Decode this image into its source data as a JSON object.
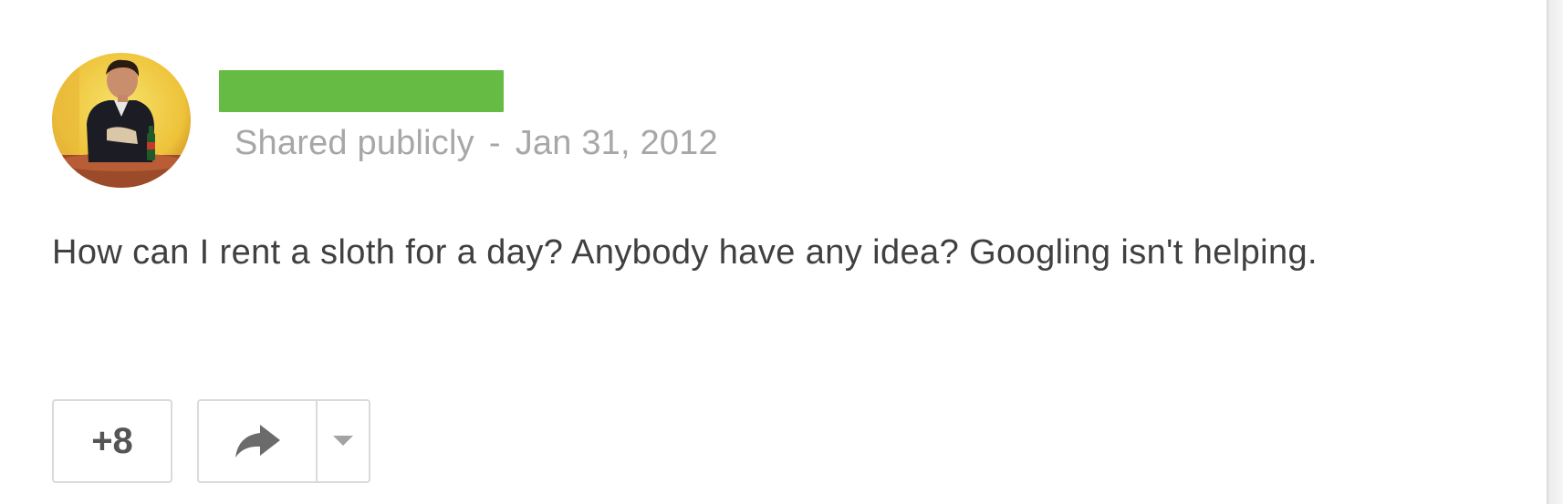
{
  "post": {
    "author": {
      "name_redaction_color": "#66bb44",
      "avatar_icon": "profile-photo"
    },
    "visibility": "Shared publicly",
    "separator": "-",
    "date": "Jan 31, 2012",
    "text": "How can I rent a sloth for a day? Anybody have any idea? Googling isn't helping.",
    "actions": {
      "plus_one_label": "+8",
      "share_icon": "share-arrow-icon",
      "share_menu_icon": "dropdown-triangle-icon"
    }
  },
  "colors": {
    "meta_text": "#a7a7a7",
    "body_text": "#404040",
    "button_border": "#dadada"
  }
}
